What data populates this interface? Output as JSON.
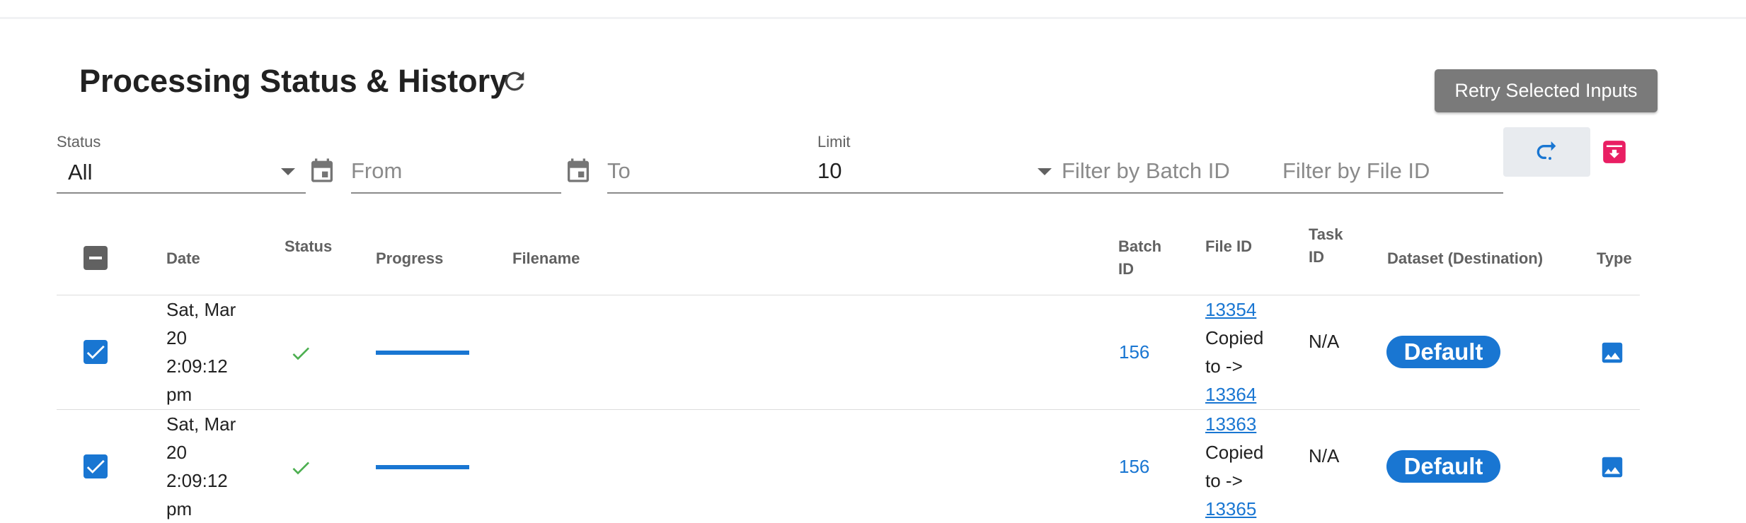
{
  "header": {
    "title": "Processing Status & History",
    "retry_label": "Retry Selected Inputs"
  },
  "filters": {
    "status_label": "Status",
    "status_value": "All",
    "from_placeholder": "From",
    "to_placeholder": "To",
    "limit_label": "Limit",
    "limit_value": "10",
    "batch_placeholder": "Filter by Batch ID",
    "file_placeholder": "Filter by File ID"
  },
  "table": {
    "columns": {
      "date": "Date",
      "status": "Status",
      "progress": "Progress",
      "filename": "Filename",
      "batch_id_1": "Batch",
      "batch_id_2": "ID",
      "file_id": "File ID",
      "task_id_1": "Task",
      "task_id_2": "ID",
      "dataset": "Dataset (Destination)",
      "type": "Type"
    },
    "rows": [
      {
        "date_1": "Sat, Mar",
        "date_2": "20",
        "date_3": "2:09:12",
        "date_4": "pm",
        "progress": 1.0,
        "filename": "",
        "batch_id": "156",
        "file_id": "13354",
        "copied_1": "Copied",
        "copied_2": "to ->",
        "copied_to": "13364",
        "task_id": "N/A",
        "dataset": "Default",
        "type_icon": "image-icon"
      },
      {
        "date_1": "Sat, Mar",
        "date_2": "20",
        "date_3": "2:09:12",
        "date_4": "pm",
        "progress": 1.0,
        "filename": "",
        "batch_id": "156",
        "file_id": "13363",
        "copied_1": "Copied",
        "copied_2": "to ->",
        "copied_to": "13365",
        "task_id": "N/A",
        "dataset": "Default",
        "type_icon": "image-icon"
      }
    ]
  },
  "colors": {
    "primary": "#1976d2",
    "success": "#4caf50",
    "archive": "#e91e63",
    "retry_button": "#7a7a7a"
  }
}
